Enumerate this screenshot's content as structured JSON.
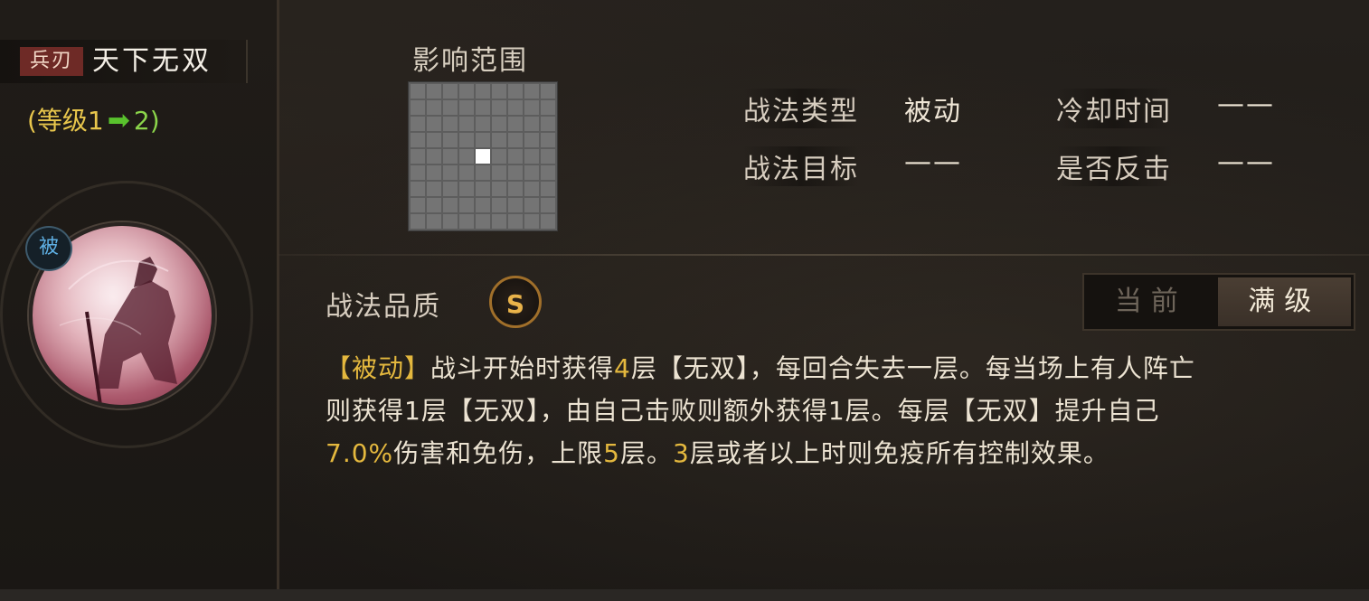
{
  "skill": {
    "weapon_tag": "兵刃",
    "name": "天下无双",
    "level_prefix": "(等级1",
    "level_arrow": "➡",
    "level_to": "2)",
    "passive_badge": "被"
  },
  "range": {
    "title": "影响范围",
    "grid_cols": 9,
    "grid_rows": 9,
    "active_cell": {
      "row": 4,
      "col": 4
    }
  },
  "info": {
    "type_label": "战法类型",
    "type_value": "被动",
    "cooldown_label": "冷却时间",
    "cooldown_value": "——",
    "target_label": "战法目标",
    "target_value": "——",
    "counter_label": "是否反击",
    "counter_value": "——"
  },
  "quality": {
    "label": "战法品质",
    "grade": "S"
  },
  "toggle": {
    "current": "当前",
    "max": "满级",
    "active": "max"
  },
  "description": {
    "line1": [
      {
        "text": "【被动】",
        "hl": true
      },
      {
        "text": "战斗开始时获得",
        "hl": false
      },
      {
        "text": "4",
        "hl": true
      },
      {
        "text": "层【无双】，每回合失去一层。每当场上有人阵亡",
        "hl": false
      }
    ],
    "line2": [
      {
        "text": "则获得1层【无双】，由自己击败则额外获得1层。每层【无双】提升自己",
        "hl": false
      }
    ],
    "line3": [
      {
        "text": "7.0%",
        "hl": true
      },
      {
        "text": "伤害和免伤，上限",
        "hl": false
      },
      {
        "text": "5",
        "hl": true
      },
      {
        "text": "层。",
        "hl": false
      },
      {
        "text": "3",
        "hl": true
      },
      {
        "text": "层或者以上时则免疫所有控制效果。",
        "hl": false
      }
    ]
  },
  "colors": {
    "highlight": "#e4b83e",
    "weapon_tag_bg": "#6e2a26",
    "level_yellow": "#e8c64c",
    "level_green": "#8bd44a",
    "passive_blue": "#5fb0e4",
    "quality_gold": "#e9b34a"
  },
  "icons": {
    "arrow": "green-right-arrow-icon",
    "portrait": "general-portrait-image",
    "quality": "s-grade-badge-icon"
  }
}
